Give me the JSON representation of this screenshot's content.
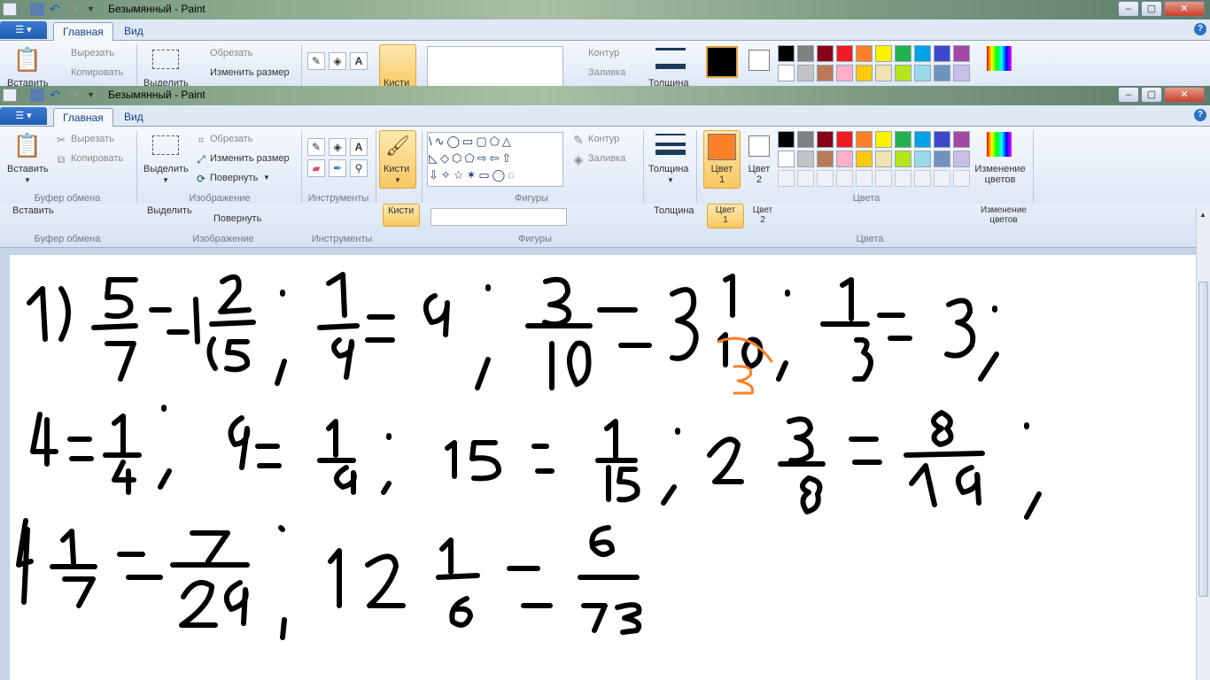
{
  "window": {
    "title": "Безымянный - Paint"
  },
  "tabs": {
    "home": "Главная",
    "view": "Вид"
  },
  "clipboard": {
    "paste": "Вставить",
    "cut": "Вырезать",
    "copy": "Копировать",
    "group": "Буфер обмена"
  },
  "image": {
    "select": "Выделить",
    "crop": "Обрезать",
    "resize": "Изменить размер",
    "rotate": "Повернуть",
    "group": "Изображение"
  },
  "tools": {
    "group": "Инструменты"
  },
  "brushes": {
    "label": "Кисти"
  },
  "shapes": {
    "outline": "Контур",
    "fill": "Заливка",
    "group": "Фигуры"
  },
  "size": {
    "label": "Толщина"
  },
  "colors": {
    "color1": "Цвет 1",
    "color2": "Цвет 2",
    "edit": "Изменение цветов",
    "group": "Цвета",
    "color1_front": "#f9812a",
    "color1_back": "#000000",
    "palette_row1": [
      "#000000",
      "#7f7f7f",
      "#880015",
      "#ed1c24",
      "#ff7f27",
      "#fff200",
      "#22b14c",
      "#00a2e8",
      "#3f48cc",
      "#a349a4"
    ],
    "palette_row2": [
      "#ffffff",
      "#c3c3c3",
      "#b97a57",
      "#ffaec9",
      "#ffc90e",
      "#efe4b0",
      "#b5e61d",
      "#99d9ea",
      "#7092be",
      "#c8bfe7"
    ]
  },
  "handwriting": {
    "line1": [
      {
        "text": "1)"
      },
      {
        "text": "5/7 = 1 2/5 ;"
      },
      {
        "text": "1/9 = 9 ;"
      },
      {
        "text": "3/10 = 3 1/10 ;"
      },
      {
        "text": "3"
      },
      {
        "text": "1/3 = 3 ;"
      }
    ],
    "line2": [
      {
        "text": "4 = 1/4 ;"
      },
      {
        "text": "9 = 1/9 ;"
      },
      {
        "text": "15 = 1/15 ;"
      },
      {
        "text": "2 3/8 = 8/19 ;"
      }
    ],
    "line3": [
      {
        "text": "4 1/7 = 7/29 ;"
      },
      {
        "text": "12 1/6 = 6/73"
      }
    ]
  }
}
